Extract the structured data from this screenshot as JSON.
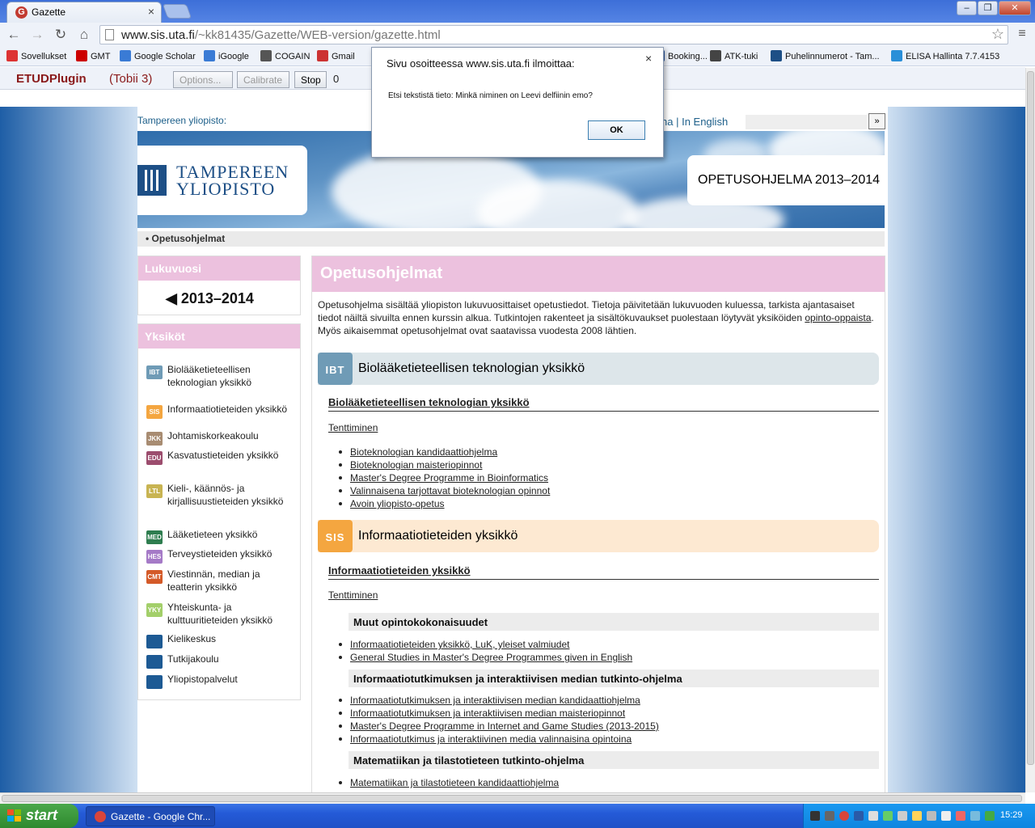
{
  "browser": {
    "tab_title": "Gazette",
    "tab_close": "×",
    "url_host": "www.sis.uta.fi",
    "url_path": "/~kk81435/Gazette/WEB-version/gazette.html",
    "window_controls": [
      "–",
      "❐",
      "✕"
    ]
  },
  "bookmarks": [
    {
      "label": "Sovellukset",
      "icon": "apps-grid-icon",
      "color": "#d33"
    },
    {
      "label": "GMT",
      "icon": "gmt-icon",
      "color": "#c00"
    },
    {
      "label": "Google Scholar",
      "icon": "scholar-icon",
      "color": "#3a7bd5"
    },
    {
      "label": "iGoogle",
      "icon": "igoogle-icon",
      "color": "#3a7bd5"
    },
    {
      "label": "COGAIN",
      "icon": "cogain-icon",
      "color": "#555"
    },
    {
      "label": "Gmail",
      "icon": "gmail-icon",
      "color": "#c33"
    },
    {
      "label": "Booking...",
      "icon": "booking-icon",
      "color": "#2a5aa8"
    },
    {
      "label": "ATK-tuki",
      "icon": "atk-icon",
      "color": "#444"
    },
    {
      "label": "Puhelinnumerot - Tam...",
      "icon": "phone-icon",
      "color": "#1d4f86"
    },
    {
      "label": "ELISA Hallinta 7.7.4153",
      "icon": "elisa-icon",
      "color": "#2a8fd8"
    }
  ],
  "plugin": {
    "name": "ETUDPlugin",
    "tracker": "(Tobii 3)",
    "options": "Options...",
    "calibrate": "Calibrate",
    "stop": "Stop",
    "count": "0"
  },
  "dialog": {
    "title": "Sivu osoitteessa www.sis.uta.fi ilmoittaa:",
    "close": "×",
    "message": "Etsi tekstistä tieto: Minkä niminen on Leevi delfiinin emo?",
    "ok": "OK"
  },
  "header": {
    "uni_label": "Tampereen yliopisto:",
    "lang_prefix": "na",
    "lang_link": "In English",
    "search_button": "»",
    "logo_line1": "TAMPEREEN",
    "logo_line2": "YLIOPISTO",
    "program_title": "OPETUSOHJELMA 2013–2014",
    "breadcrumb": "• Opetusohjelmat"
  },
  "sidebar": {
    "year_title": "Lukuvuosi",
    "year_value": "◀ 2013–2014",
    "units_title": "Yksiköt",
    "units": [
      {
        "badge": "IBT",
        "color": "#6f9bb6",
        "label": "Biolääketieteellisen teknologian yksikkö"
      },
      {
        "badge": "SIS",
        "color": "#f4a640",
        "label": "Informaatiotieteiden yksikkö"
      },
      {
        "badge": "JKK",
        "color": "#a88c72",
        "label": "Johtamiskorkeakoulu"
      },
      {
        "badge": "EDU",
        "color": "#9c4d6e",
        "label": "Kasvatustieteiden yksikkö"
      },
      {
        "badge": "LTL",
        "color": "#c8b452",
        "label": "Kieli-, käännös- ja kirjallisuustieteiden yksikkö"
      },
      {
        "badge": "MED",
        "color": "#2e7d4f",
        "label": "Lääketieteen yksikkö"
      },
      {
        "badge": "HES",
        "color": "#a57ac7",
        "label": "Terveystieteiden yksikkö"
      },
      {
        "badge": "CMT",
        "color": "#d45a28",
        "label": "Viestinnän, median ja teatterin yksikkö"
      },
      {
        "badge": "YKY",
        "color": "#a3cf6a",
        "label": "Yhteiskunta- ja kulttuuritieteiden yksikkö"
      },
      {
        "badge": "",
        "color": "#1d5a94",
        "label": "Kielikeskus"
      },
      {
        "badge": "",
        "color": "#1d5a94",
        "label": "Tutkijakoulu"
      },
      {
        "badge": "",
        "color": "#1d5a94",
        "label": "Yliopistopalvelut"
      }
    ]
  },
  "main": {
    "title": "Opetusohjelmat",
    "intro_a": "Opetusohjelma sisältää yliopiston lukuvuosittaiset opetustiedot. Tietoja päivitetään lukuvuoden kuluessa, tarkista ajantasaiset tiedot näiltä sivuilta ennen kurssin alkua. Tutkintojen rakenteet ja sisältökuvaukset puolestaan löytyvät yksiköiden ",
    "intro_link": "opinto-oppaista",
    "intro_b": ". Myös aikaisemmat opetusohjelmat ovat saatavissa vuodesta 2008 lähtien.",
    "ibt": {
      "chip": "IBT",
      "color": "#6f9bb6",
      "bg": "#dde6ea",
      "title": "Biolääketieteellisen teknologian yksikkö",
      "subtitle": "Biolääketieteellisen teknologian yksikkö",
      "exams": "Tenttiminen",
      "links": [
        "Bioteknologian kandidaattiohjelma",
        "Bioteknologian maisteriopinnot",
        "Master's Degree Programme in Bioinformatics",
        "Valinnaisena tarjottavat bioteknologian opinnot",
        "Avoin yliopisto-opetus"
      ]
    },
    "sis": {
      "chip": "SIS",
      "color": "#f4a640",
      "bg": "#fde9d2",
      "title": "Informaatiotieteiden yksikkö",
      "subtitle": "Informaatiotieteiden yksikkö",
      "exams": "Tenttiminen",
      "group1": "Muut opintokokonaisuudet",
      "group1_links": [
        "Informaatiotieteiden yksikkö, LuK, yleiset valmiudet",
        "General Studies in Master's Degree Programmes given in English"
      ],
      "group2": "Informaatiotutkimuksen ja interaktiivisen median tutkinto-ohjelma",
      "group2_links": [
        "Informaatiotutkimuksen ja interaktiivisen median kandidaattiohjelma",
        "Informaatiotutkimuksen ja interaktiivisen median maisteriopinnot",
        "Master's Degree Programme in Internet and Game Studies (2013-2015)",
        "Informaatiotutkimus ja interaktiivinen media valinnaisina opintoina"
      ],
      "group3": "Matematiikan ja tilastotieteen tutkinto-ohjelma",
      "group3_links": [
        "Matematiikan ja tilastotieteen kandidaattiohjelma"
      ]
    }
  },
  "taskbar": {
    "start": "start",
    "item": "Gazette - Google Chr...",
    "clock": "15:29"
  }
}
